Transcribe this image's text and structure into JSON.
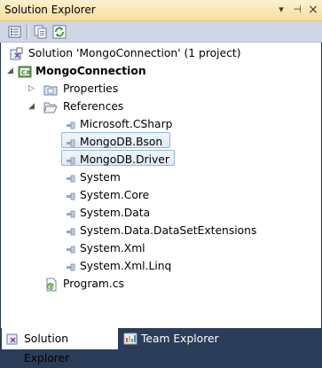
{
  "panel": {
    "title": "Solution Explorer"
  },
  "titlebar_buttons": {
    "dropdown": "▾",
    "pin": "⊣",
    "close": "×"
  },
  "toolbar": {
    "buttons": [
      {
        "name": "properties-icon"
      },
      {
        "name": "show-all-files-icon"
      },
      {
        "name": "refresh-icon"
      }
    ]
  },
  "tree": {
    "solution": "Solution 'MongoConnection' (1 project)",
    "project": "MongoConnection",
    "properties": "Properties",
    "references": "References",
    "reference_items": [
      "Microsoft.CSharp",
      "MongoDB.Bson",
      "MongoDB.Driver",
      "System",
      "System.Core",
      "System.Data",
      "System.Data.DataSetExtensions",
      "System.Xml",
      "System.Xml.Linq"
    ],
    "file": "Program.cs"
  },
  "tabs": [
    {
      "label": "Solution Explorer",
      "active": true
    },
    {
      "label": "Team Explorer",
      "active": false
    }
  ],
  "colors": {
    "accent": "#f5df9e",
    "selection": "#dde9f9",
    "frame": "#293955"
  }
}
